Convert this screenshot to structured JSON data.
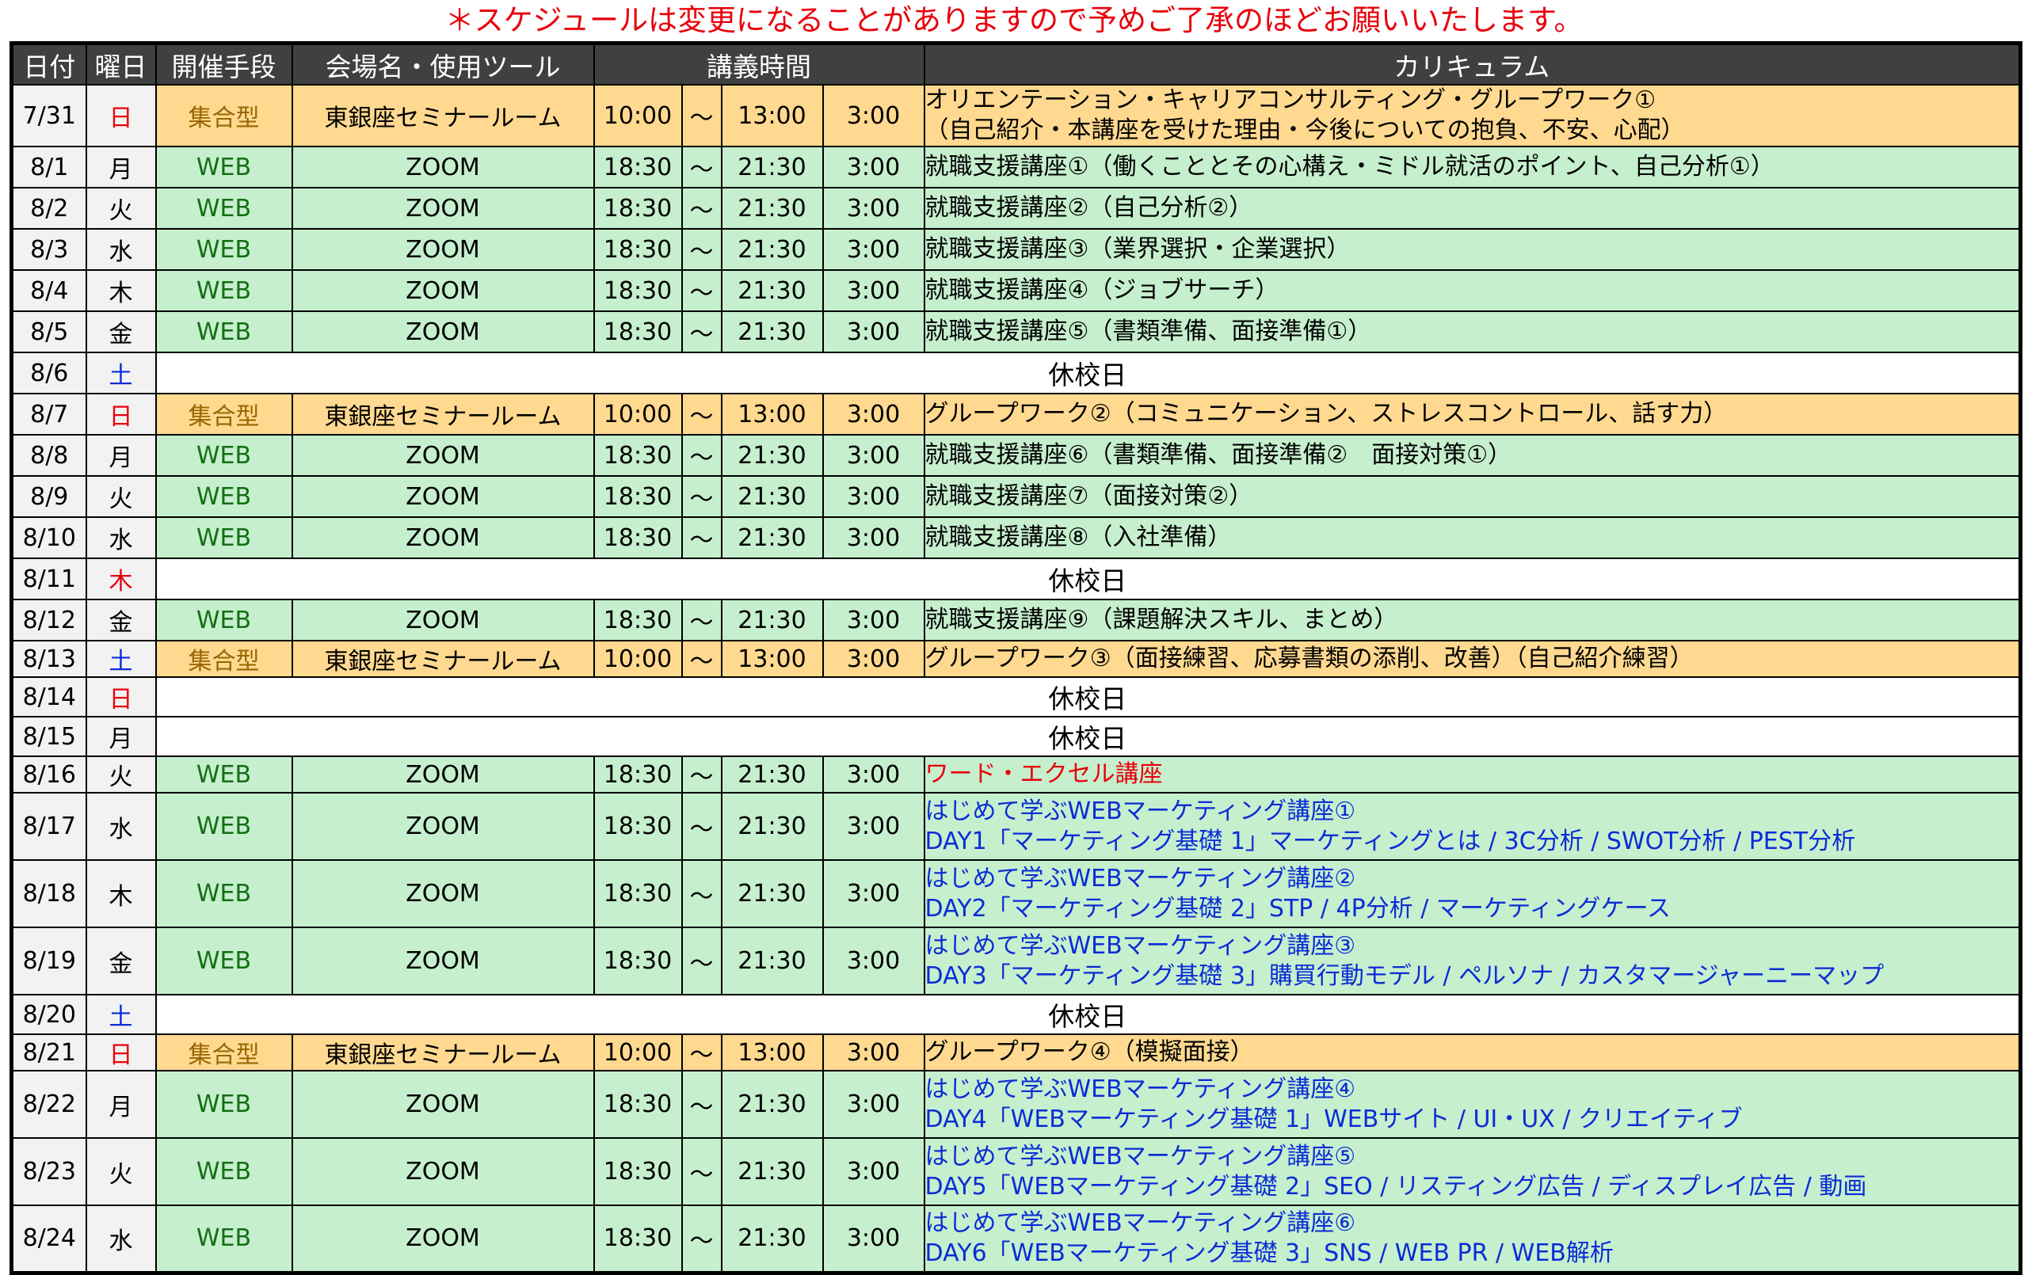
{
  "notice": "＊スケジュールは変更になることがありますので予めご了承のほどお願いいたします。",
  "headers": {
    "date": "日付",
    "day": "曜日",
    "mode": "開催手段",
    "venue": "会場名・使用ツール",
    "time": "講義時間",
    "curriculum": "カリキュラム"
  },
  "colors": {
    "web_bg": "#c6efce",
    "meet_bg": "#ffd98f",
    "header_bg": "#404040",
    "red": "#e8000b",
    "blue": "#0b2cd6",
    "web_text": "#146e14",
    "meet_text": "#996600"
  },
  "rows": [
    {
      "type": "meet",
      "date": "7/31",
      "day": "日",
      "dayColor": "red",
      "mode": "集合型",
      "venue": "東銀座セミナールーム",
      "start": "10:00",
      "sep": "～",
      "end": "13:00",
      "dur": "3:00",
      "lines": [
        "オリエンテーション・キャリアコンサルティング・グループワーク①",
        "（自己紹介・本講座を受けた理由・今後についての抱負、不安、心配）"
      ],
      "color": "black",
      "h": 77
    },
    {
      "type": "web",
      "date": "8/1",
      "day": "月",
      "dayColor": "black",
      "mode": "WEB",
      "venue": "ZOOM",
      "start": "18:30",
      "sep": "～",
      "end": "21:30",
      "dur": "3:00",
      "lines": [
        "就職支援講座①（働くこととその心構え・ミドル就活のポイント、自己分析①）"
      ],
      "color": "black",
      "h": 52
    },
    {
      "type": "web",
      "date": "8/2",
      "day": "火",
      "dayColor": "black",
      "mode": "WEB",
      "venue": "ZOOM",
      "start": "18:30",
      "sep": "～",
      "end": "21:30",
      "dur": "3:00",
      "lines": [
        "就職支援講座②（自己分析②）"
      ],
      "color": "black",
      "h": 52
    },
    {
      "type": "web",
      "date": "8/3",
      "day": "水",
      "dayColor": "black",
      "mode": "WEB",
      "venue": "ZOOM",
      "start": "18:30",
      "sep": "～",
      "end": "21:30",
      "dur": "3:00",
      "lines": [
        "就職支援講座③（業界選択・企業選択）"
      ],
      "color": "black",
      "h": 52
    },
    {
      "type": "web",
      "date": "8/4",
      "day": "木",
      "dayColor": "black",
      "mode": "WEB",
      "venue": "ZOOM",
      "start": "18:30",
      "sep": "～",
      "end": "21:30",
      "dur": "3:00",
      "lines": [
        "就職支援講座④（ジョブサーチ）"
      ],
      "color": "black",
      "h": 52
    },
    {
      "type": "web",
      "date": "8/5",
      "day": "金",
      "dayColor": "black",
      "mode": "WEB",
      "venue": "ZOOM",
      "start": "18:30",
      "sep": "～",
      "end": "21:30",
      "dur": "3:00",
      "lines": [
        "就職支援講座⑤（書類準備、面接準備①）"
      ],
      "color": "black",
      "h": 52
    },
    {
      "type": "closed",
      "date": "8/6",
      "day": "土",
      "dayColor": "blue",
      "rest": "休校日",
      "h": 52
    },
    {
      "type": "meet",
      "date": "8/7",
      "day": "日",
      "dayColor": "red",
      "mode": "集合型",
      "venue": "東銀座セミナールーム",
      "start": "10:00",
      "sep": "～",
      "end": "13:00",
      "dur": "3:00",
      "lines": [
        "グループワーク②（コミュニケーション、ストレスコントロール、話す力）"
      ],
      "color": "black",
      "h": 52
    },
    {
      "type": "web",
      "date": "8/8",
      "day": "月",
      "dayColor": "black",
      "mode": "WEB",
      "venue": "ZOOM",
      "start": "18:30",
      "sep": "～",
      "end": "21:30",
      "dur": "3:00",
      "lines": [
        "就職支援講座⑥（書類準備、面接準備②　面接対策①）"
      ],
      "color": "black",
      "h": 52
    },
    {
      "type": "web",
      "date": "8/9",
      "day": "火",
      "dayColor": "black",
      "mode": "WEB",
      "venue": "ZOOM",
      "start": "18:30",
      "sep": "～",
      "end": "21:30",
      "dur": "3:00",
      "lines": [
        "就職支援講座⑦（面接対策②）"
      ],
      "color": "black",
      "h": 52
    },
    {
      "type": "web",
      "date": "8/10",
      "day": "水",
      "dayColor": "black",
      "mode": "WEB",
      "venue": "ZOOM",
      "start": "18:30",
      "sep": "～",
      "end": "21:30",
      "dur": "3:00",
      "lines": [
        "就職支援講座⑧（入社準備）"
      ],
      "color": "black",
      "h": 52
    },
    {
      "type": "closed",
      "date": "8/11",
      "day": "木",
      "dayColor": "red",
      "rest": "休校日",
      "h": 52
    },
    {
      "type": "web",
      "date": "8/12",
      "day": "金",
      "dayColor": "black",
      "mode": "WEB",
      "venue": "ZOOM",
      "start": "18:30",
      "sep": "～",
      "end": "21:30",
      "dur": "3:00",
      "lines": [
        "就職支援講座⑨（課題解決スキル、まとめ）"
      ],
      "color": "black",
      "h": 52
    },
    {
      "type": "meet",
      "date": "8/13",
      "day": "土",
      "dayColor": "blue",
      "mode": "集合型",
      "venue": "東銀座セミナールーム",
      "start": "10:00",
      "sep": "～",
      "end": "13:00",
      "dur": "3:00",
      "lines": [
        "グループワーク③（面接練習、応募書類の添削、改善）（自己紹介練習）"
      ],
      "color": "black",
      "h": 44
    },
    {
      "type": "closed",
      "date": "8/14",
      "day": "日",
      "dayColor": "red",
      "rest": "休校日",
      "h": 44
    },
    {
      "type": "closed",
      "date": "8/15",
      "day": "月",
      "dayColor": "black",
      "rest": "休校日",
      "h": 44
    },
    {
      "type": "web",
      "date": "8/16",
      "day": "火",
      "dayColor": "black",
      "mode": "WEB",
      "venue": "ZOOM",
      "start": "18:30",
      "sep": "～",
      "end": "21:30",
      "dur": "3:00",
      "lines": [
        "ワード・エクセル講座"
      ],
      "color": "red",
      "h": 44
    },
    {
      "type": "web",
      "date": "8/17",
      "day": "水",
      "dayColor": "black",
      "mode": "WEB",
      "venue": "ZOOM",
      "start": "18:30",
      "sep": "～",
      "end": "21:30",
      "dur": "3:00",
      "lines": [
        "はじめて学ぶWEBマーケティング講座①",
        "DAY1「マーケティング基礎 1」マーケティングとは / 3C分析 / SWOT分析 / PEST分析"
      ],
      "color": "blue",
      "h": 85
    },
    {
      "type": "web",
      "date": "8/18",
      "day": "木",
      "dayColor": "black",
      "mode": "WEB",
      "venue": "ZOOM",
      "start": "18:30",
      "sep": "～",
      "end": "21:30",
      "dur": "3:00",
      "lines": [
        "はじめて学ぶWEBマーケティング講座②",
        "DAY2「マーケティング基礎 2」STP / 4P分析 / マーケティングケース"
      ],
      "color": "blue",
      "h": 85
    },
    {
      "type": "web",
      "date": "8/19",
      "day": "金",
      "dayColor": "black",
      "mode": "WEB",
      "venue": "ZOOM",
      "start": "18:30",
      "sep": "～",
      "end": "21:30",
      "dur": "3:00",
      "lines": [
        "はじめて学ぶWEBマーケティング講座③",
        "DAY3「マーケティング基礎 3」購買行動モデル / ペルソナ / カスタマージャーニーマップ"
      ],
      "color": "blue",
      "h": 85
    },
    {
      "type": "closed",
      "date": "8/20",
      "day": "土",
      "dayColor": "blue",
      "rest": "休校日",
      "h": 44
    },
    {
      "type": "meet",
      "date": "8/21",
      "day": "日",
      "dayColor": "red",
      "mode": "集合型",
      "venue": "東銀座セミナールーム",
      "start": "10:00",
      "sep": "～",
      "end": "13:00",
      "dur": "3:00",
      "lines": [
        "グループワーク④（模擬面接）"
      ],
      "color": "black",
      "h": 44
    },
    {
      "type": "web",
      "date": "8/22",
      "day": "月",
      "dayColor": "black",
      "mode": "WEB",
      "venue": "ZOOM",
      "start": "18:30",
      "sep": "～",
      "end": "21:30",
      "dur": "3:00",
      "lines": [
        "はじめて学ぶWEBマーケティング講座④",
        "DAY4「WEBマーケティング基礎 1」WEBサイト / UI・UX / クリエイティブ"
      ],
      "color": "blue",
      "h": 85
    },
    {
      "type": "web",
      "date": "8/23",
      "day": "火",
      "dayColor": "black",
      "mode": "WEB",
      "venue": "ZOOM",
      "start": "18:30",
      "sep": "～",
      "end": "21:30",
      "dur": "3:00",
      "lines": [
        "はじめて学ぶWEBマーケティング講座⑤",
        "DAY5「WEBマーケティング基礎 2」SEO / リスティング広告 / ディスプレイ広告 / 動画"
      ],
      "color": "blue",
      "h": 85
    },
    {
      "type": "web",
      "date": "8/24",
      "day": "水",
      "dayColor": "black",
      "mode": "WEB",
      "venue": "ZOOM",
      "start": "18:30",
      "sep": "～",
      "end": "21:30",
      "dur": "3:00",
      "lines": [
        "はじめて学ぶWEBマーケティング講座⑥",
        "DAY6「WEBマーケティング基礎 3」SNS / WEB PR / WEB解析"
      ],
      "color": "blue",
      "h": 85
    }
  ]
}
